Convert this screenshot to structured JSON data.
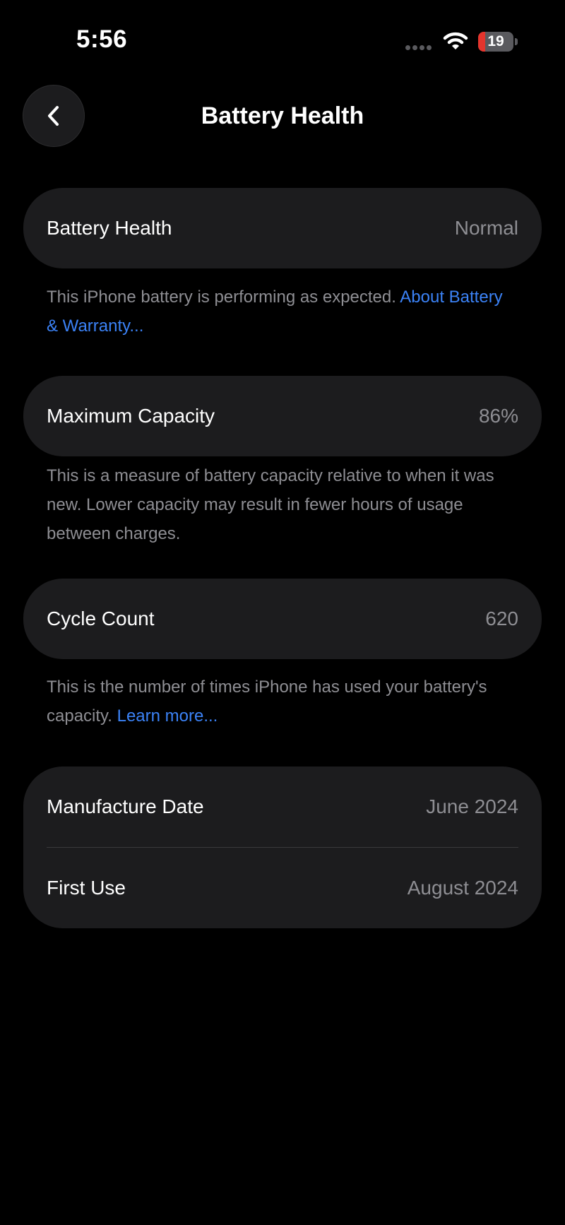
{
  "status_bar": {
    "time": "5:56",
    "battery_level": "19",
    "battery_fraction": 0.19,
    "battery_color": "#e5352d",
    "wifi_icon": "wifi-icon",
    "signal_icon": "signal-dots-icon"
  },
  "nav": {
    "title": "Battery Health",
    "back_icon": "chevron-left-icon"
  },
  "battery_health": {
    "label": "Battery Health",
    "value": "Normal",
    "footnote": "This iPhone battery is performing as expected. ",
    "link": "About Battery & Warranty..."
  },
  "maximum_capacity": {
    "label": "Maximum Capacity",
    "value": "86%",
    "footnote": "This is a measure of battery capacity relative to when it was new. Lower capacity may result in fewer hours of usage between charges."
  },
  "cycle_count": {
    "label": "Cycle Count",
    "value": "620",
    "footnote": "This is the number of times iPhone has used your battery's capacity. ",
    "link": "Learn more..."
  },
  "dates": {
    "manufacture_label": "Manufacture Date",
    "manufacture_value": "June 2024",
    "first_use_label": "First Use",
    "first_use_value": "August 2024"
  },
  "colors": {
    "background": "#000000",
    "card": "#1c1c1e",
    "secondary_text": "#8e8e93",
    "link": "#3b82f6"
  }
}
